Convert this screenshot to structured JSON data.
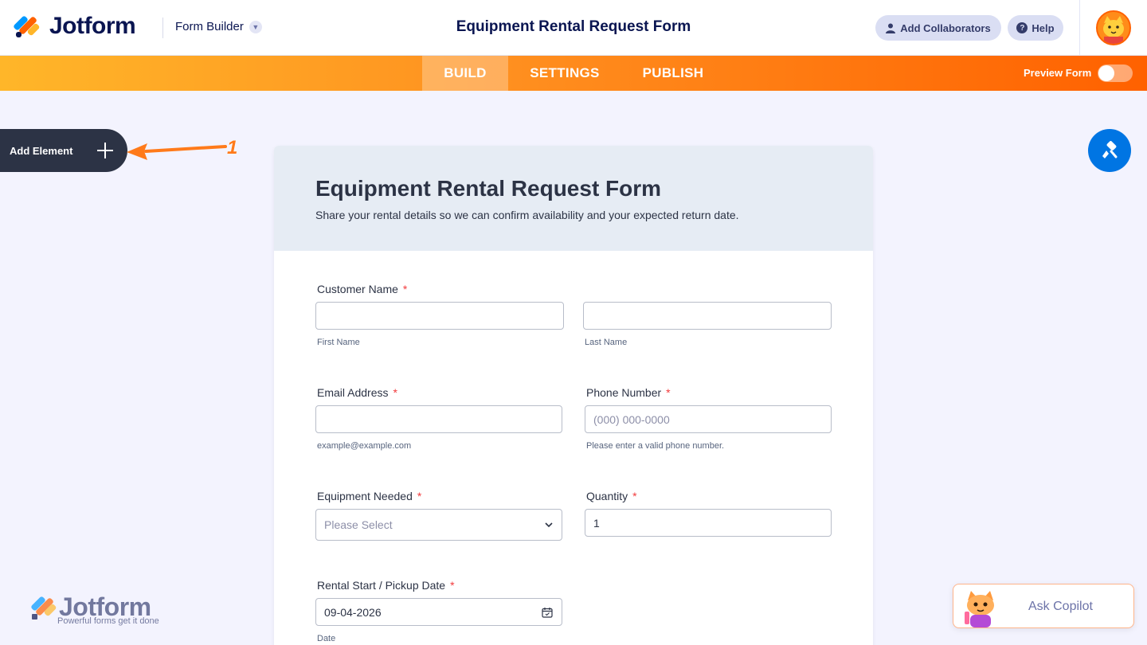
{
  "header": {
    "brand": "Jotform",
    "builder_label": "Form Builder",
    "title": "Equipment Rental Request Form",
    "collaborators_label": "Add Collaborators",
    "help_label": "Help"
  },
  "nav": {
    "tabs": [
      "BUILD",
      "SETTINGS",
      "PUBLISH"
    ],
    "active": "BUILD",
    "preview_label": "Preview Form",
    "preview_on": false
  },
  "sidebar": {
    "add_element_label": "Add Element",
    "annotation_number": "1"
  },
  "form": {
    "title": "Equipment Rental Request Form",
    "subtitle": "Share your rental details so we can confirm availability and your expected return date.",
    "customer_name": {
      "label": "Customer Name",
      "required": "*",
      "first_sublabel": "First Name",
      "last_sublabel": "Last Name"
    },
    "email": {
      "label": "Email Address",
      "required": "*",
      "sublabel": "example@example.com"
    },
    "phone": {
      "label": "Phone Number",
      "required": "*",
      "placeholder": "(000) 000-0000",
      "sublabel": "Please enter a valid phone number."
    },
    "equipment": {
      "label": "Equipment Needed",
      "required": "*",
      "placeholder": "Please Select"
    },
    "quantity": {
      "label": "Quantity",
      "required": "*",
      "value": "1"
    },
    "start_date": {
      "label": "Rental Start / Pickup Date",
      "required": "*",
      "value": "09-04-2026",
      "sublabel": "Date"
    }
  },
  "watermark": {
    "brand": "Jotform",
    "tagline": "Powerful forms get it done"
  },
  "copilot": {
    "label": "Ask Copilot"
  },
  "colors": {
    "accent": "#ff6100",
    "brand_dark": "#0a1551",
    "blue": "#0075e3",
    "required": "#f23a3c"
  }
}
